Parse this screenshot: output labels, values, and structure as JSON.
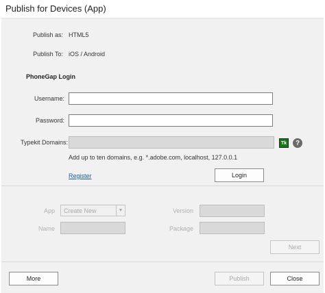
{
  "window": {
    "title": "Publish for Devices (App)"
  },
  "publish": {
    "as_label": "Publish as:",
    "as_value": "HTML5",
    "to_label": "Publish To:",
    "to_value": "iOS / Android"
  },
  "phonegap": {
    "heading": "PhoneGap Login",
    "username_label": "Username:",
    "username_value": "",
    "password_label": "Password:",
    "password_value": "",
    "typekit_label": "Typekit Domains:",
    "typekit_value": "",
    "typekit_icon_text": "Tk",
    "help_icon_text": "?",
    "hint": "Add up to ten domains, e.g. *.adobe.com, localhost, 127.0.0.1",
    "register_link": "Register",
    "login_button": "Login"
  },
  "app": {
    "app_label": "App",
    "app_select_value": "Create New",
    "name_label": "Name",
    "name_value": "",
    "version_label": "Version",
    "version_value": "",
    "package_label": "Package",
    "package_value": "",
    "next_button": "Next"
  },
  "footer": {
    "more_button": "More",
    "publish_button": "Publish",
    "close_button": "Close"
  }
}
